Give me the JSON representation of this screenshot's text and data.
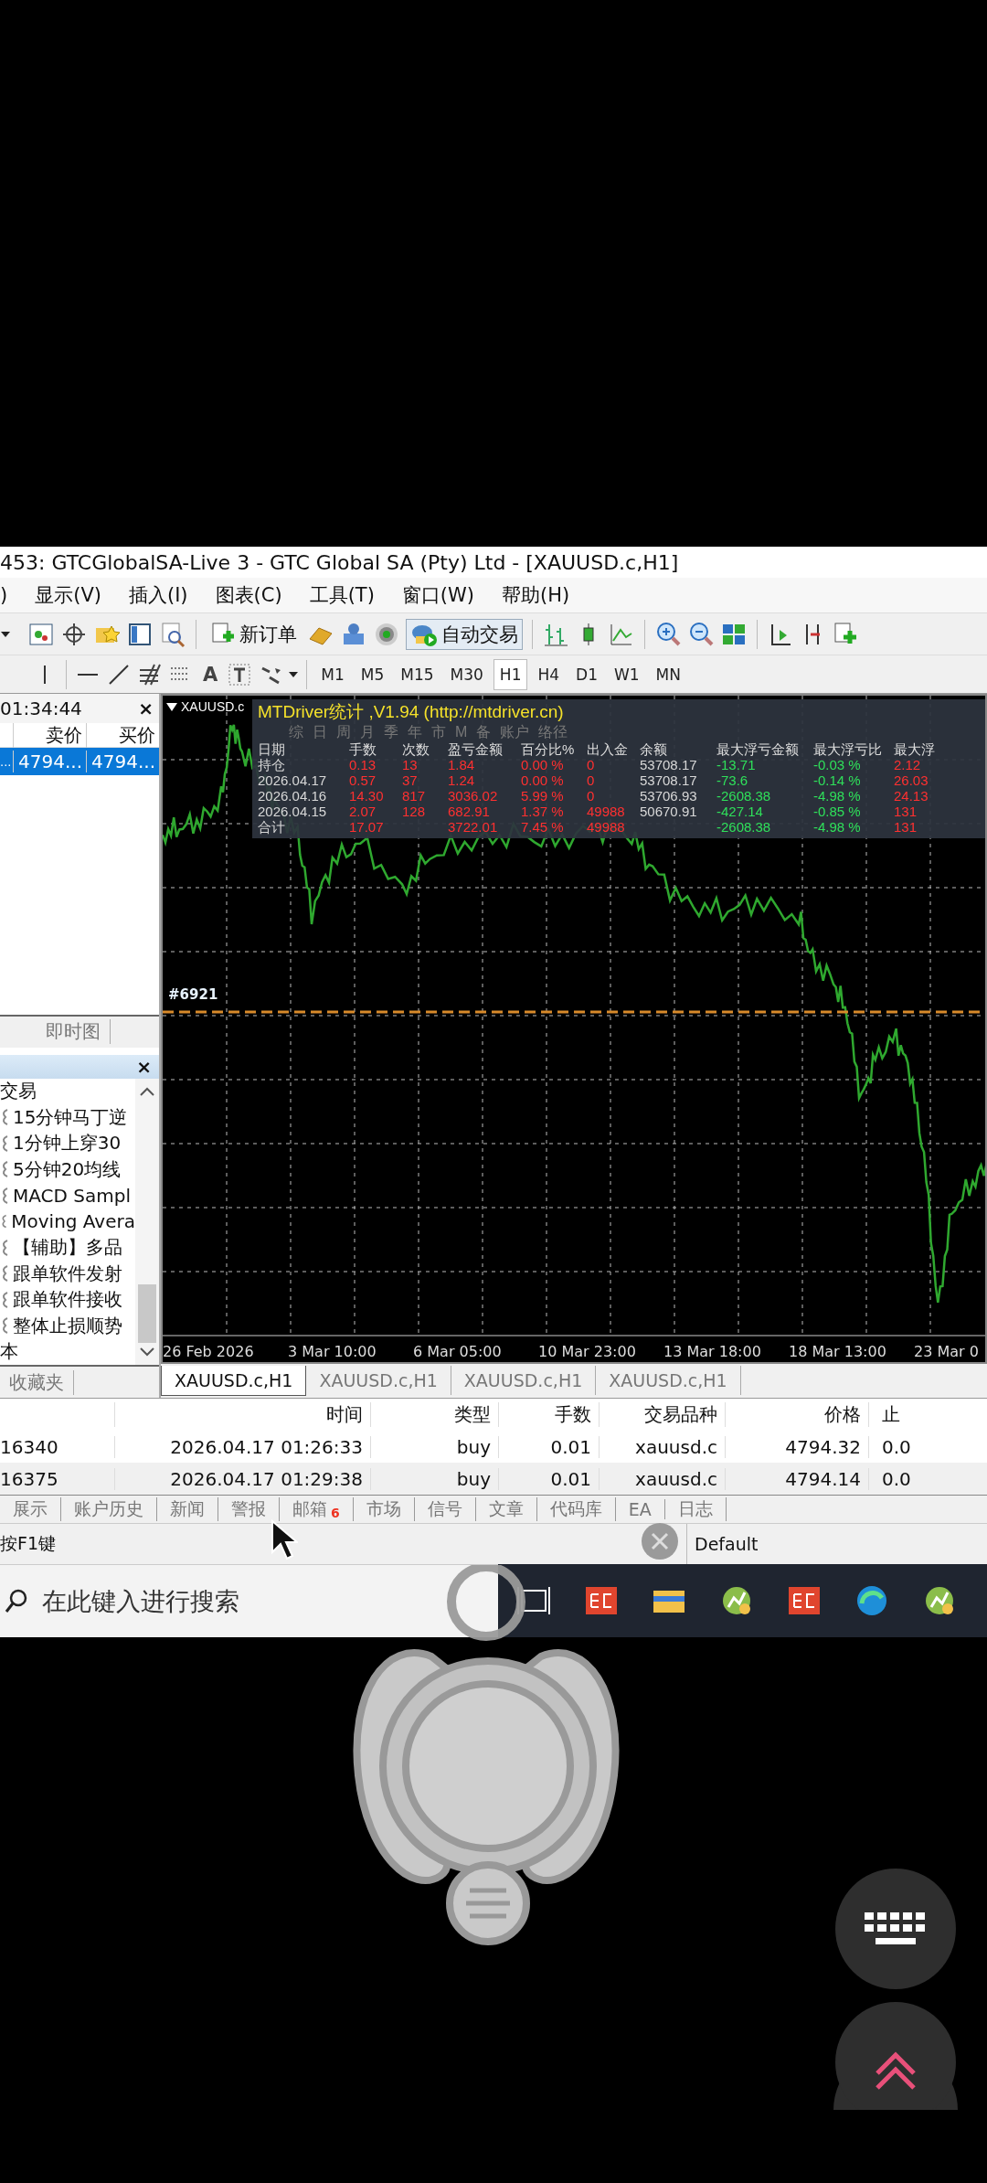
{
  "window": {
    "title": "453: GTCGlobalSA-Live 3 - GTC Global SA (Pty) Ltd - [XAUUSD.c,H1]"
  },
  "menu": [
    ")",
    "显示(V)",
    "插入(I)",
    "图表(C)",
    "工具(T)",
    "窗口(W)",
    "帮助(H)"
  ],
  "toolbar": {
    "new_order": "新订单",
    "auto_trading": "自动交易",
    "text_tool": "A"
  },
  "timeframes": [
    {
      "label": "M1",
      "selected": false
    },
    {
      "label": "M5",
      "selected": false
    },
    {
      "label": "M15",
      "selected": false
    },
    {
      "label": "M30",
      "selected": false
    },
    {
      "label": "H1",
      "selected": true
    },
    {
      "label": "H4",
      "selected": false
    },
    {
      "label": "D1",
      "selected": false
    },
    {
      "label": "W1",
      "selected": false
    },
    {
      "label": "MN",
      "selected": false
    }
  ],
  "market_watch": {
    "time": "01:34:44",
    "close": "×",
    "columns": [
      "卖价",
      "买价"
    ],
    "rows": [
      {
        "symbol": "...",
        "bid": "4794...",
        "ask": "4794...",
        "selected": true
      }
    ],
    "tabs": [
      "即时图"
    ]
  },
  "navigator": {
    "close": "×",
    "items": [
      {
        "label": "交易",
        "children": [
          {
            "label": "15分钟马丁逆"
          },
          {
            "label": "1分钟上穿30"
          },
          {
            "label": "5分钟20均线"
          },
          {
            "label": "MACD Sampl"
          },
          {
            "label": "Moving Avera"
          },
          {
            "label": "【辅助】多品"
          },
          {
            "label": "跟单软件发射"
          },
          {
            "label": "跟单软件接收"
          },
          {
            "label": "整体止损顺势"
          }
        ]
      },
      {
        "label": "本"
      }
    ],
    "tabs": [
      "收藏夹"
    ]
  },
  "chart": {
    "symbol": "XAUUSD.c",
    "order_label": "#6921",
    "time_labels": [
      "26 Feb 2026",
      "3 Mar 10:00",
      "6 Mar 05:00",
      "10 Mar 23:00",
      "13 Mar 18:00",
      "18 Mar 13:00",
      "23 Mar 0"
    ],
    "tabs": [
      {
        "label": "XAUUSD.c,H1",
        "selected": true
      },
      {
        "label": "XAUUSD.c,H1",
        "selected": false
      },
      {
        "label": "XAUUSD.c,H1",
        "selected": false
      },
      {
        "label": "XAUUSD.c,H1",
        "selected": false
      }
    ]
  },
  "mtdriver": {
    "title": "MTDriver统计 ,V1.94 (http://mtdriver.cn)",
    "tabs": [
      "综",
      "日",
      "周",
      "月",
      "季",
      "年",
      "市",
      "M",
      "备",
      "账户",
      "络径"
    ],
    "columns": [
      {
        "label": "日期",
        "color": "#d8d8d8"
      },
      {
        "label": "手数",
        "color": "#ff3030"
      },
      {
        "label": "次数",
        "color": "#ff3030"
      },
      {
        "label": "盈亏金额",
        "color": "#ff3030"
      },
      {
        "label": "百分比%",
        "color": "#ff3030"
      },
      {
        "label": "出入金",
        "color": "#ff3030"
      },
      {
        "label": "余额",
        "color": "#d8d8d8"
      },
      {
        "label": "最大浮亏金额",
        "color": "#2fe05a"
      },
      {
        "label": "最大浮亏比",
        "color": "#2fe05a"
      },
      {
        "label": "最大浮",
        "color": "#ff3030"
      }
    ],
    "rows": [
      [
        "持仓",
        "0.13",
        "13",
        "1.84",
        "0.00 %",
        "0",
        "53708.17",
        "-13.71",
        "-0.03 %",
        "2.12"
      ],
      [
        "2026.04.17",
        "0.57",
        "37",
        "1.24",
        "0.00 %",
        "0",
        "53708.17",
        "-73.6",
        "-0.14 %",
        "26.03"
      ],
      [
        "2026.04.16",
        "14.30",
        "817",
        "3036.02",
        "5.99 %",
        "0",
        "53706.93",
        "-2608.38",
        "-4.98 %",
        "24.13"
      ],
      [
        "2026.04.15",
        "2.07",
        "128",
        "682.91",
        "1.37 %",
        "49988",
        "50670.91",
        "-427.14",
        "-0.85 %",
        "131"
      ],
      [
        "合计",
        "17.07",
        "",
        "3722.01",
        "7.45 %",
        "49988",
        "",
        "-2608.38",
        "-4.98 %",
        "131"
      ]
    ]
  },
  "terminal": {
    "columns": [
      "时间",
      "类型",
      "手数",
      "交易品种",
      "价格",
      "止"
    ],
    "rows": [
      {
        "order": "16340",
        "cells": [
          "2026.04.17 01:26:33",
          "buy",
          "0.01",
          "xauusd.c",
          "4794.32",
          "0.0"
        ]
      },
      {
        "order": "16375",
        "cells": [
          "2026.04.17 01:29:38",
          "buy",
          "0.01",
          "xauusd.c",
          "4794.14",
          "0.0"
        ]
      }
    ],
    "tabs": [
      {
        "label": "展示"
      },
      {
        "label": "账户历史"
      },
      {
        "label": "新闻"
      },
      {
        "label": "警报"
      },
      {
        "label": "邮箱",
        "badge": "6"
      },
      {
        "label": "市场"
      },
      {
        "label": "信号"
      },
      {
        "label": "文章"
      },
      {
        "label": "代码库"
      },
      {
        "label": "EA"
      },
      {
        "label": "日志"
      }
    ]
  },
  "status_bar": {
    "hint": "按F1键",
    "profile": "Default"
  },
  "taskbar": {
    "search_placeholder": "在此键入进行搜索"
  }
}
